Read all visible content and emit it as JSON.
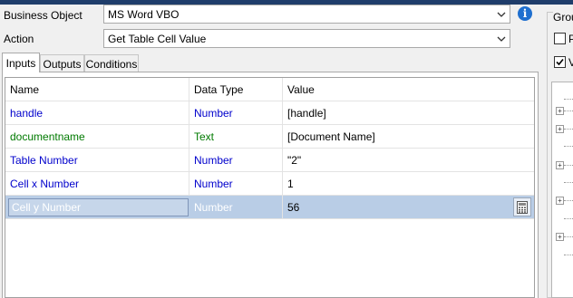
{
  "form": {
    "business_object_label": "Business Object",
    "business_object_value": "MS Word VBO",
    "action_label": "Action",
    "action_value": "Get Table Cell Value"
  },
  "tabs": [
    {
      "label": "Inputs",
      "active": true
    },
    {
      "label": "Outputs",
      "active": false
    },
    {
      "label": "Conditions",
      "active": false
    }
  ],
  "grid": {
    "headers": [
      "Name",
      "Data Type",
      "Value"
    ],
    "rows": [
      {
        "name": "handle",
        "type": "Number",
        "value": "[handle]",
        "color": "blue"
      },
      {
        "name": "documentname",
        "type": "Text",
        "value": "[Document Name]",
        "color": "green"
      },
      {
        "name": "Table Number",
        "type": "Number",
        "value": "\"2\"",
        "color": "blue"
      },
      {
        "name": "Cell x Number",
        "type": "Number",
        "value": "1",
        "color": "blue"
      },
      {
        "name": "Cell y Number",
        "type": "Number",
        "value": "56",
        "color": "white",
        "selected": true
      }
    ]
  },
  "right_panel": {
    "group_label": "Grou",
    "check1_label": "P",
    "check2_label": "V",
    "check1_checked": false,
    "check2_checked": true
  },
  "colors": {
    "blue_text": "#0000cc",
    "green_text": "#007a00",
    "selection": "#b9cde6",
    "info_icon": "#1e6fcf"
  }
}
